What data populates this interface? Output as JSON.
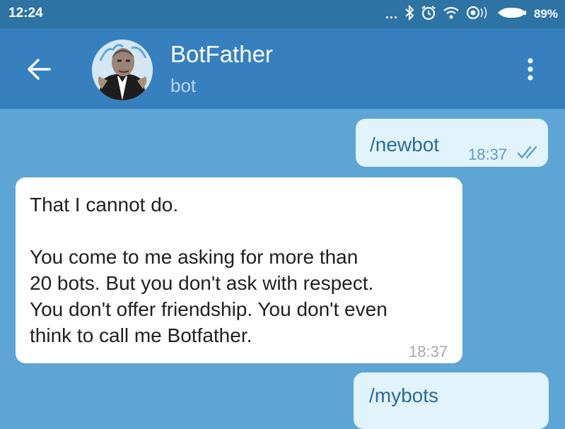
{
  "status_bar": {
    "time": "12:24",
    "more": "...",
    "battery_percent": "89%",
    "icons": [
      "bluetooth-icon",
      "alarm-icon",
      "wifi-icon",
      "sync-icon",
      "battery-icon"
    ]
  },
  "header": {
    "title": "BotFather",
    "subtitle": "bot",
    "back_icon": "arrow-left-icon",
    "menu_icon": "more-vert-icon"
  },
  "messages": [
    {
      "direction": "outgoing",
      "text": "/newbot",
      "time": "18:37",
      "status_icon": "double-check-icon"
    },
    {
      "direction": "incoming",
      "text": "That I cannot do.\n\nYou come to me asking for more than\n20 bots. But you don't ask with respect.\nYou don't offer friendship. You don't even\nthink to call me Botfather.",
      "time": "18:37"
    },
    {
      "direction": "outgoing",
      "text": "/mybots"
    }
  ],
  "colors": {
    "status_bar": "#2d73a3",
    "app_bar": "#3680bf",
    "chat_background": "#5ca5d4",
    "outgoing_bubble": "#e1f3fb",
    "incoming_bubble": "#ffffff",
    "outgoing_text": "#2a6a96"
  }
}
